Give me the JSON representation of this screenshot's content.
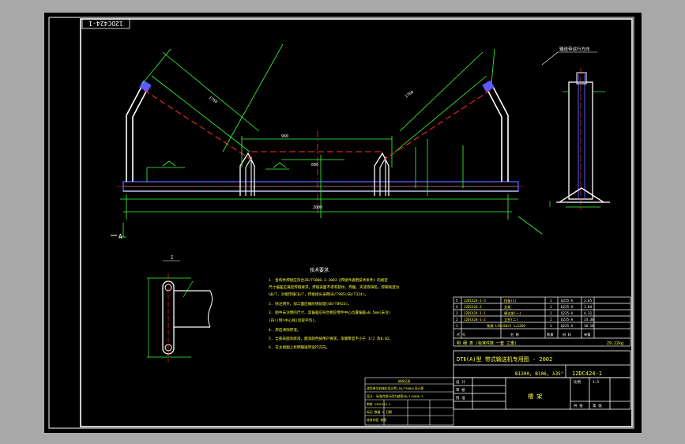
{
  "drawing": {
    "code_top_box": "12DC424-1",
    "code_title_block": "12DC424-1",
    "title_line": "DTⅡ(A)型  带式输送机专用图 - 2002",
    "spec_line": "B1200, B106, λ35°",
    "part_name": "槽 架",
    "weight_text": "29.22kg",
    "mass_label": "明  细  表  (标准件数 一套 之重)",
    "detail_label": "I",
    "view_marker": "A",
    "direction_note": "输送带运行方向",
    "dimension_overall": "2000"
  },
  "tech_requirements": {
    "title": "技术要求",
    "items": [
      "1. 各构件焊接应符合JB/T5000.3-2003《焊接件通用技术条件》的规定",
      "   尺寸偏差应满足焊缝要求，焊缝表面不得有裂纹、焊瘤、夹渣等缺陷，焊脚高度为",
      "   GB/T，对接焊缝CB/T，焊接接头采用GB/T985(GB/T324)。",
      "2. 除注明外，加工面应做防锈处理(GB/T8923)。",
      "3. 图中未注明的尺寸，其偏差应符合相应零件中心位置偏差±0.5mm(未注)",
      "   (符)(制)中心线(且取平均)。",
      "4. 焊后清除焊渣。",
      "5. 全部表面涂底漆，面漆颜色按用户要求，漆膜厚度不小于 1/2 及0.02。",
      "6. 在主视图上标明输送带运行方向。"
    ]
  },
  "parts_table": {
    "rows": [
      {
        "no": "5",
        "code": "12DC424-1-3",
        "name": "挡板(2)",
        "qty": "1",
        "material": "Q235-A",
        "weight": "2.65"
      },
      {
        "no": "4",
        "code": "12DC424-3",
        "name": "支架",
        "qty": "1",
        "material": "Q235-A",
        "weight": "1.84"
      },
      {
        "no": "3",
        "code": "12DC424-1-1",
        "name": "横支架(一)",
        "qty": "1",
        "material": "Q235-A",
        "weight": "4.31"
      },
      {
        "no": "2",
        "code": "12DC424-1-2",
        "name": "立柱(二)",
        "qty": "2",
        "material": "Q235-A",
        "weight": "14.30"
      },
      {
        "no": "1",
        "code": "",
        "name": "角钢 L50×50×5 L=1260",
        "qty": "1",
        "material": "Q235-A",
        "weight": "10.18"
      }
    ],
    "header": [
      "代 号",
      "名  称",
      "数量",
      "材 料",
      "单重"
    ]
  },
  "title_block": {
    "design_label": "设  计",
    "check_label": "审  核",
    "approve_label": "批  准",
    "scale_label": "比例",
    "scale_value": "1:5",
    "sheet_label": "共 张",
    "sheet_of": "第 张"
  },
  "revision_table": {
    "title": "修改记录",
    "rows": [
      "改用单位机械化设计院(JB/T5000)设计部",
      "设计: 标准件部分改为使用GB/T/5000.3",
      "审核  12DC424-1",
      "标记  数量  2 日期",
      "修改内容  按图"
    ]
  }
}
